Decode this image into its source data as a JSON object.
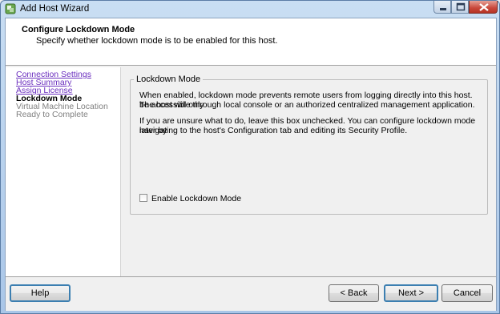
{
  "window": {
    "title": "Add Host Wizard"
  },
  "header": {
    "title": "Configure Lockdown Mode",
    "subtitle": "Specify whether lockdown mode is to be enabled for this host."
  },
  "nav": {
    "items": [
      {
        "label": "Connection Settings",
        "state": "completed"
      },
      {
        "label": "Host Summary",
        "state": "completed"
      },
      {
        "label": "Assign License",
        "state": "completed"
      },
      {
        "label": "Lockdown Mode",
        "state": "current"
      },
      {
        "label": "Virtual Machine Location",
        "state": "upcoming"
      },
      {
        "label": "Ready to Complete",
        "state": "upcoming"
      }
    ]
  },
  "main": {
    "group_label": "Lockdown Mode",
    "paragraph1_line1": "When enabled, lockdown mode prevents remote users from logging directly into this host. The host will only",
    "paragraph1_line2": "be accessible through local console or an authorized centralized management application.",
    "paragraph2_line1": "If you are unsure what to do, leave this box unchecked. You can configure lockdown mode later by",
    "paragraph2_line2": "navigating to the host's Configuration tab and editing its Security Profile.",
    "checkbox_label": "Enable Lockdown Mode",
    "checkbox_checked": false
  },
  "footer": {
    "help_label": "Help",
    "back_label": "< Back",
    "next_label": "Next >",
    "cancel_label": "Cancel"
  },
  "colors": {
    "link": "#6b2fbf",
    "upcoming": "#808080",
    "default_button_border": "#3c7fb1"
  }
}
